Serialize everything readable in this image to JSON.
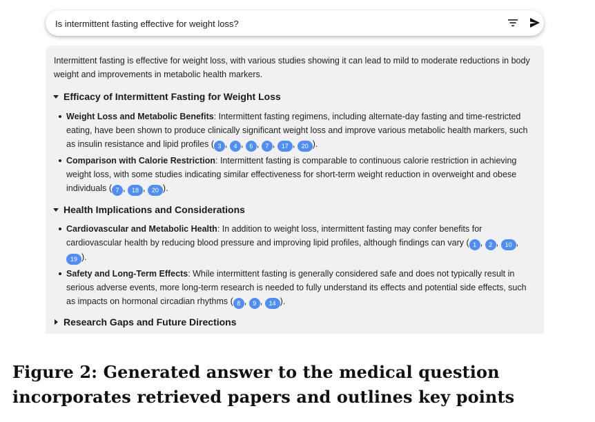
{
  "search": {
    "query": "Is intermittent fasting effective for weight loss?",
    "filter_icon": "filter-icon",
    "send_icon": "send-icon"
  },
  "answer": {
    "intro": "Intermittent fasting is effective for weight loss, with various studies showing it can lead to mild to moderate reductions in body weight and improvements in metabolic health markers.",
    "sections": [
      {
        "title": "Efficacy of Intermittent Fasting for Weight Loss",
        "expanded": true,
        "items": [
          {
            "label": "Weight Loss and Metabolic Benefits",
            "text": ": Intermittent fasting regimens, including alternate-day fasting and time-restricted eating, have been shown to produce clinically significant weight loss and improve various metabolic health markers, such as insulin resistance and lipid profiles (",
            "citations": [
              "3",
              "4",
              "6",
              "7",
              "17",
              "20"
            ],
            "end": ")."
          },
          {
            "label": "Comparison with Calorie Restriction",
            "text": ": Intermittent fasting is comparable to continuous calorie restriction in achieving weight loss, with some studies indicating similar effectiveness for short-term weight reduction in overweight and obese individuals (",
            "citations": [
              "7",
              "18",
              "20"
            ],
            "end": ")."
          }
        ]
      },
      {
        "title": "Health Implications and Considerations",
        "expanded": true,
        "items": [
          {
            "label": "Cardiovascular and Metabolic Health",
            "text": ": In addition to weight loss, intermittent fasting may confer benefits for cardiovascular health by reducing blood pressure and improving lipid profiles, although findings can vary (",
            "citations": [
              "1",
              "2",
              "10",
              "19"
            ],
            "end": ")."
          },
          {
            "label": "Safety and Long-Term Effects",
            "text": ": While intermittent fasting is generally considered safe and does not typically result in serious adverse events, more long-term research is needed to fully understand its effects and potential side effects, such as impacts on hormonal circadian rhythms (",
            "citations": [
              "8",
              "9",
              "14"
            ],
            "end": ")."
          }
        ]
      },
      {
        "title": "Research Gaps and Future Directions",
        "expanded": false,
        "items": []
      }
    ]
  },
  "caption": "Figure 2: Generated answer to the medical question incorporates retrieved papers and outlines key points",
  "colors": {
    "citation_badge": "#4f8ef7",
    "panel_background": "#f1f1f1"
  }
}
